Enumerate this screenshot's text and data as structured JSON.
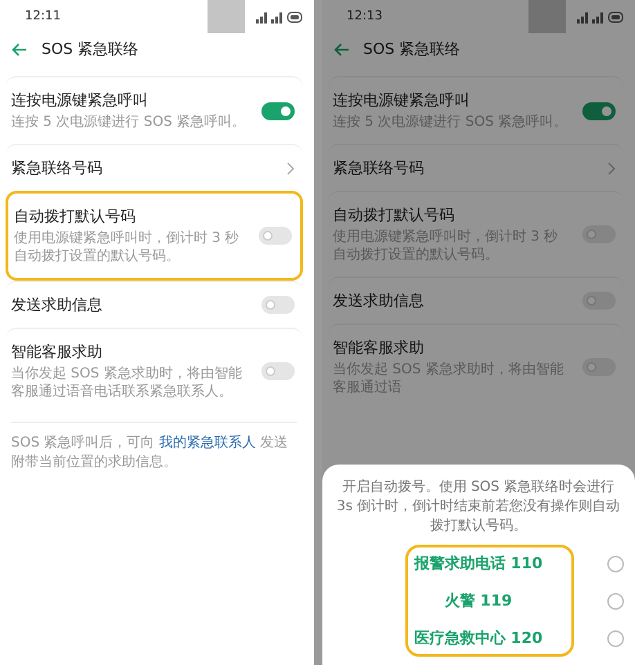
{
  "panels": [
    {
      "status_bar": {
        "time": "12:11"
      },
      "title": "SOS 紧急联络",
      "settings": [
        {
          "kind": "toggle",
          "label": "连按电源键紧急呼叫",
          "description": "连按 5 次电源键进行 SOS 紧急呼叫。",
          "on": true,
          "highlighted": false
        },
        {
          "kind": "link",
          "label": "紧急联络号码",
          "highlighted": false
        },
        {
          "kind": "toggle",
          "label": "自动拨打默认号码",
          "description": "使用电源键紧急呼叫时，倒计时 3 秒自动拨打设置的默认号码。",
          "on": false,
          "highlighted": true
        },
        {
          "kind": "toggle",
          "label": "发送求助信息",
          "on": false,
          "highlighted": false
        },
        {
          "kind": "toggle",
          "label": "智能客服求助",
          "description": "当你发起 SOS 紧急求助时，将由智能客服通过语音电话联系紧急联系人。",
          "on": false,
          "highlighted": false
        }
      ],
      "footer": {
        "before": "SOS 紧急呼叫后，可向 ",
        "link": "我的紧急联系人",
        "after": " 发送附带当前位置的求助信息。"
      }
    },
    {
      "status_bar": {
        "time": "12:13"
      },
      "title": "SOS 紧急联络",
      "settings": [
        {
          "kind": "toggle",
          "label": "连按电源键紧急呼叫",
          "description": "连按 5 次电源键进行 SOS 紧急呼叫。",
          "on": true,
          "highlighted": false
        },
        {
          "kind": "link",
          "label": "紧急联络号码",
          "highlighted": false
        },
        {
          "kind": "toggle",
          "label": "自动拨打默认号码",
          "description": "使用电源键紧急呼叫时，倒计时 3 秒自动拨打设置的默认号码。",
          "on": false,
          "highlighted": false
        },
        {
          "kind": "toggle",
          "label": "发送求助信息",
          "on": false,
          "highlighted": false
        },
        {
          "kind": "toggle",
          "label": "智能客服求助",
          "description": "当你发起 SOS 紧急求助时，将由智能客服通过语",
          "on": false,
          "highlighted": false
        }
      ],
      "sheet": {
        "message": "开启自动拨号。使用 SOS 紧急联络时会进行 3s 倒计时，倒计时结束前若您没有操作则自动拨打默认号码。",
        "options_highlighted": true,
        "options": [
          {
            "label": "报警求助电话 110",
            "selected": false
          },
          {
            "label": "火警 119",
            "selected": false
          },
          {
            "label": "医疗急救中心 120",
            "selected": false
          }
        ]
      }
    }
  ]
}
